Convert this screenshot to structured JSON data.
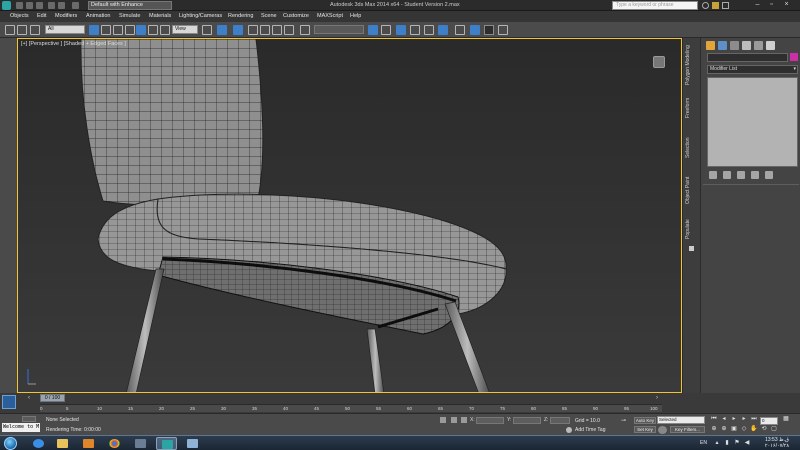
{
  "title_bar": {
    "workspace": "Default with Enhance",
    "window_title": "Autodesk 3ds Max 2014 x64 - Student Version   2.max",
    "search_placeholder": "Type a keyword or phrase"
  },
  "menu": [
    "Objects",
    "Edit",
    "Modifiers",
    "Animation",
    "Simulate",
    "Materials",
    "Lighting/Cameras",
    "Rendering",
    "Scene",
    "Customize",
    "MAXScript",
    "Help"
  ],
  "toolbar": {
    "selection_filter": "All",
    "reference_coord": "View",
    "named_selection": ""
  },
  "viewport": {
    "label": "[+] [Perspective ] [Shaded + Edged Faces ]"
  },
  "ribbon_tabs": [
    "Polygon Modeling",
    "Freeform",
    "Selection",
    "Object Paint",
    "Populate"
  ],
  "command_panel": {
    "modifier_list": "Modifier List"
  },
  "timeline": {
    "slider": "0 / 100",
    "ticks": [
      "0",
      "5",
      "10",
      "15",
      "20",
      "25",
      "30",
      "35",
      "40",
      "45",
      "50",
      "55",
      "60",
      "65",
      "70",
      "75",
      "80",
      "85",
      "90",
      "95",
      "100"
    ]
  },
  "status": {
    "listener": "Welcome to M",
    "selection": "None Selected",
    "prompt": "Rendering Time: 0:00:00",
    "x_label": "X:",
    "y_label": "Y:",
    "z_label": "Z:",
    "grid": "Grid = 10.0",
    "add_time_tag": "Add Time Tag",
    "auto_key": "Auto Key",
    "set_key": "Set Key",
    "key_mode": "Selected",
    "key_filters": "Key Filters...",
    "frame": "0"
  },
  "taskbar": {
    "lang": "EN",
    "clock_time": "13:53",
    "clock_ampm": "ق.ظ",
    "clock_date": "۲۰۱۶/۰۷/۲۸"
  },
  "colors": {
    "viewport_border": "#f1c531",
    "object_color": "#cc2fa5",
    "app_icon": "#2aa4a4"
  }
}
